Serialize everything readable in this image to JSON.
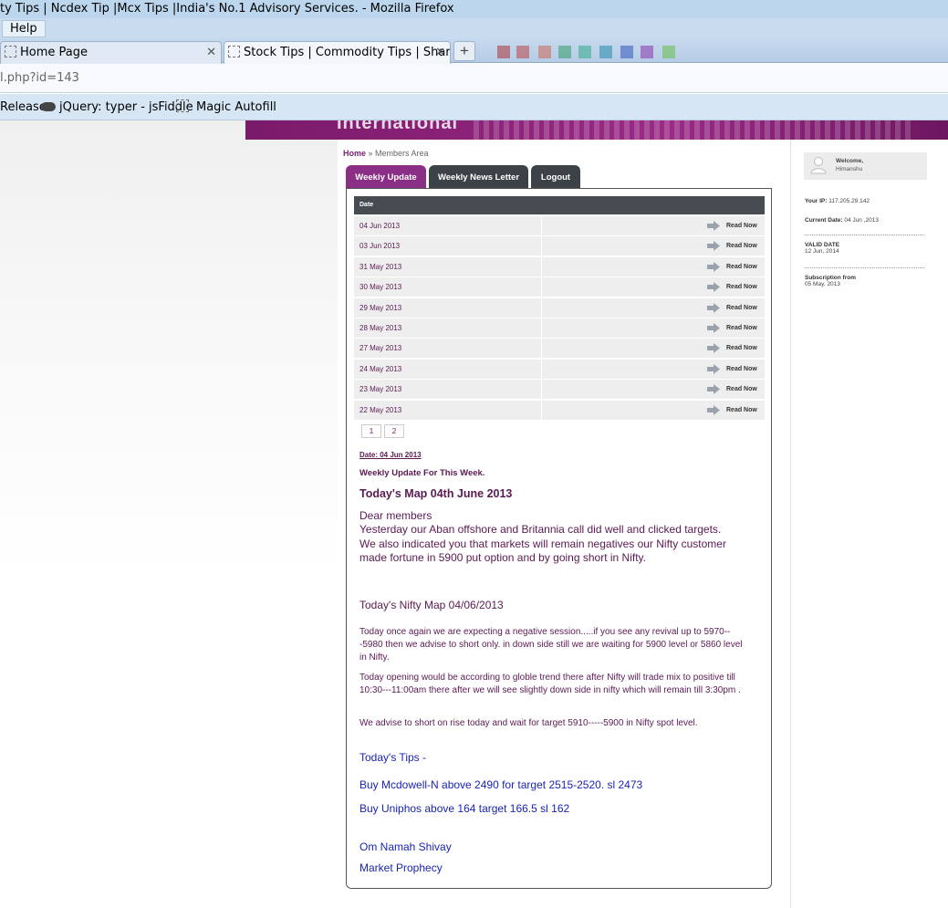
{
  "browser": {
    "window_title": "ty Tips | Ncdex Tip |Mcx Tips |India's No.1 Advisory Services. - Mozilla Firefox",
    "menu_help": "Help",
    "tabs": [
      {
        "label": "Home Page"
      },
      {
        "label": "Stock Tips | Commodity Tips | Share ..."
      }
    ],
    "url": "l.php?id=143",
    "bookmarks": [
      {
        "label": "Releases"
      },
      {
        "label": "jQuery: typer - jsFiddle"
      },
      {
        "label": "Magic Autofill"
      }
    ]
  },
  "banner": {
    "text": "International"
  },
  "breadcrumb": {
    "home": "Home",
    "sep": " » ",
    "current": "Members Area"
  },
  "tabs": [
    {
      "label": "Weekly Update"
    },
    {
      "label": "Weekly News Letter"
    },
    {
      "label": "Logout"
    }
  ],
  "table": {
    "header": "Date",
    "read_label": "Read Now",
    "rows": [
      {
        "date": "04 Jun 2013"
      },
      {
        "date": "03 Jun 2013"
      },
      {
        "date": "31 May 2013"
      },
      {
        "date": "30 May 2013"
      },
      {
        "date": "29 May 2013"
      },
      {
        "date": "28 May 2013"
      },
      {
        "date": "27 May 2013"
      },
      {
        "date": "24 May 2013"
      },
      {
        "date": "23 May 2013"
      },
      {
        "date": "22 May 2013"
      }
    ]
  },
  "pagination": [
    "1",
    "2"
  ],
  "content": {
    "date_label": "Date: 04 Jun 2013",
    "week_title": "Weekly Update For This Week.",
    "map_title": "Today's Map 04th June 2013",
    "body": [
      "Dear members",
      "Yesterday our Aban offshore and Britannia call did well and clicked targets.",
      "We also indicated you that markets will remain negatives our Nifty customer made fortune in 5900 put option and by going short in Nifty."
    ],
    "nifty_title": "Today's Nifty Map 04/06/2013",
    "paragraphs": [
      "Today once again we are expecting a negative session.....if you see any revival up to 5970---5980 then we advise to short only. in down side still we are waiting for 5900 level or 5860 level in Nifty.",
      "Today opening would be according to globle trend there after Nifty will trade mix to positive till 10:30---11:00am there after we will see slightly down side in nifty which will remain till 3:30pm .",
      "We advise to short on rise today and wait for target 5910-----5900 in Nifty spot level."
    ],
    "tips_title": "Today's Tips -",
    "tips": [
      "Buy Mcdowell-N above 2490 for target 2515-2520. sl 2473",
      "Buy Uniphos above 164 target 166.5 sl 162"
    ],
    "signoff": [
      "Om Namah Shivay",
      "Market Prophecy"
    ]
  },
  "sidebar": {
    "welcome": "Welcome,",
    "user": "Himanshu",
    "ip_label": "Your IP:",
    "ip": "117.205.29.142",
    "current_date_label": "Current Date:",
    "current_date": "04 Jun ,2013",
    "valid_label": "VALID DATE",
    "valid_date": "12 Jun, 2014",
    "sub_label": "Subscription from",
    "sub_date": "05 May, 2013"
  },
  "colors": {
    "brand_purple": "#8b2f86",
    "tab_dark": "#3d4248",
    "text_purple": "#5a1a52",
    "link_blue": "#1a24b3"
  }
}
